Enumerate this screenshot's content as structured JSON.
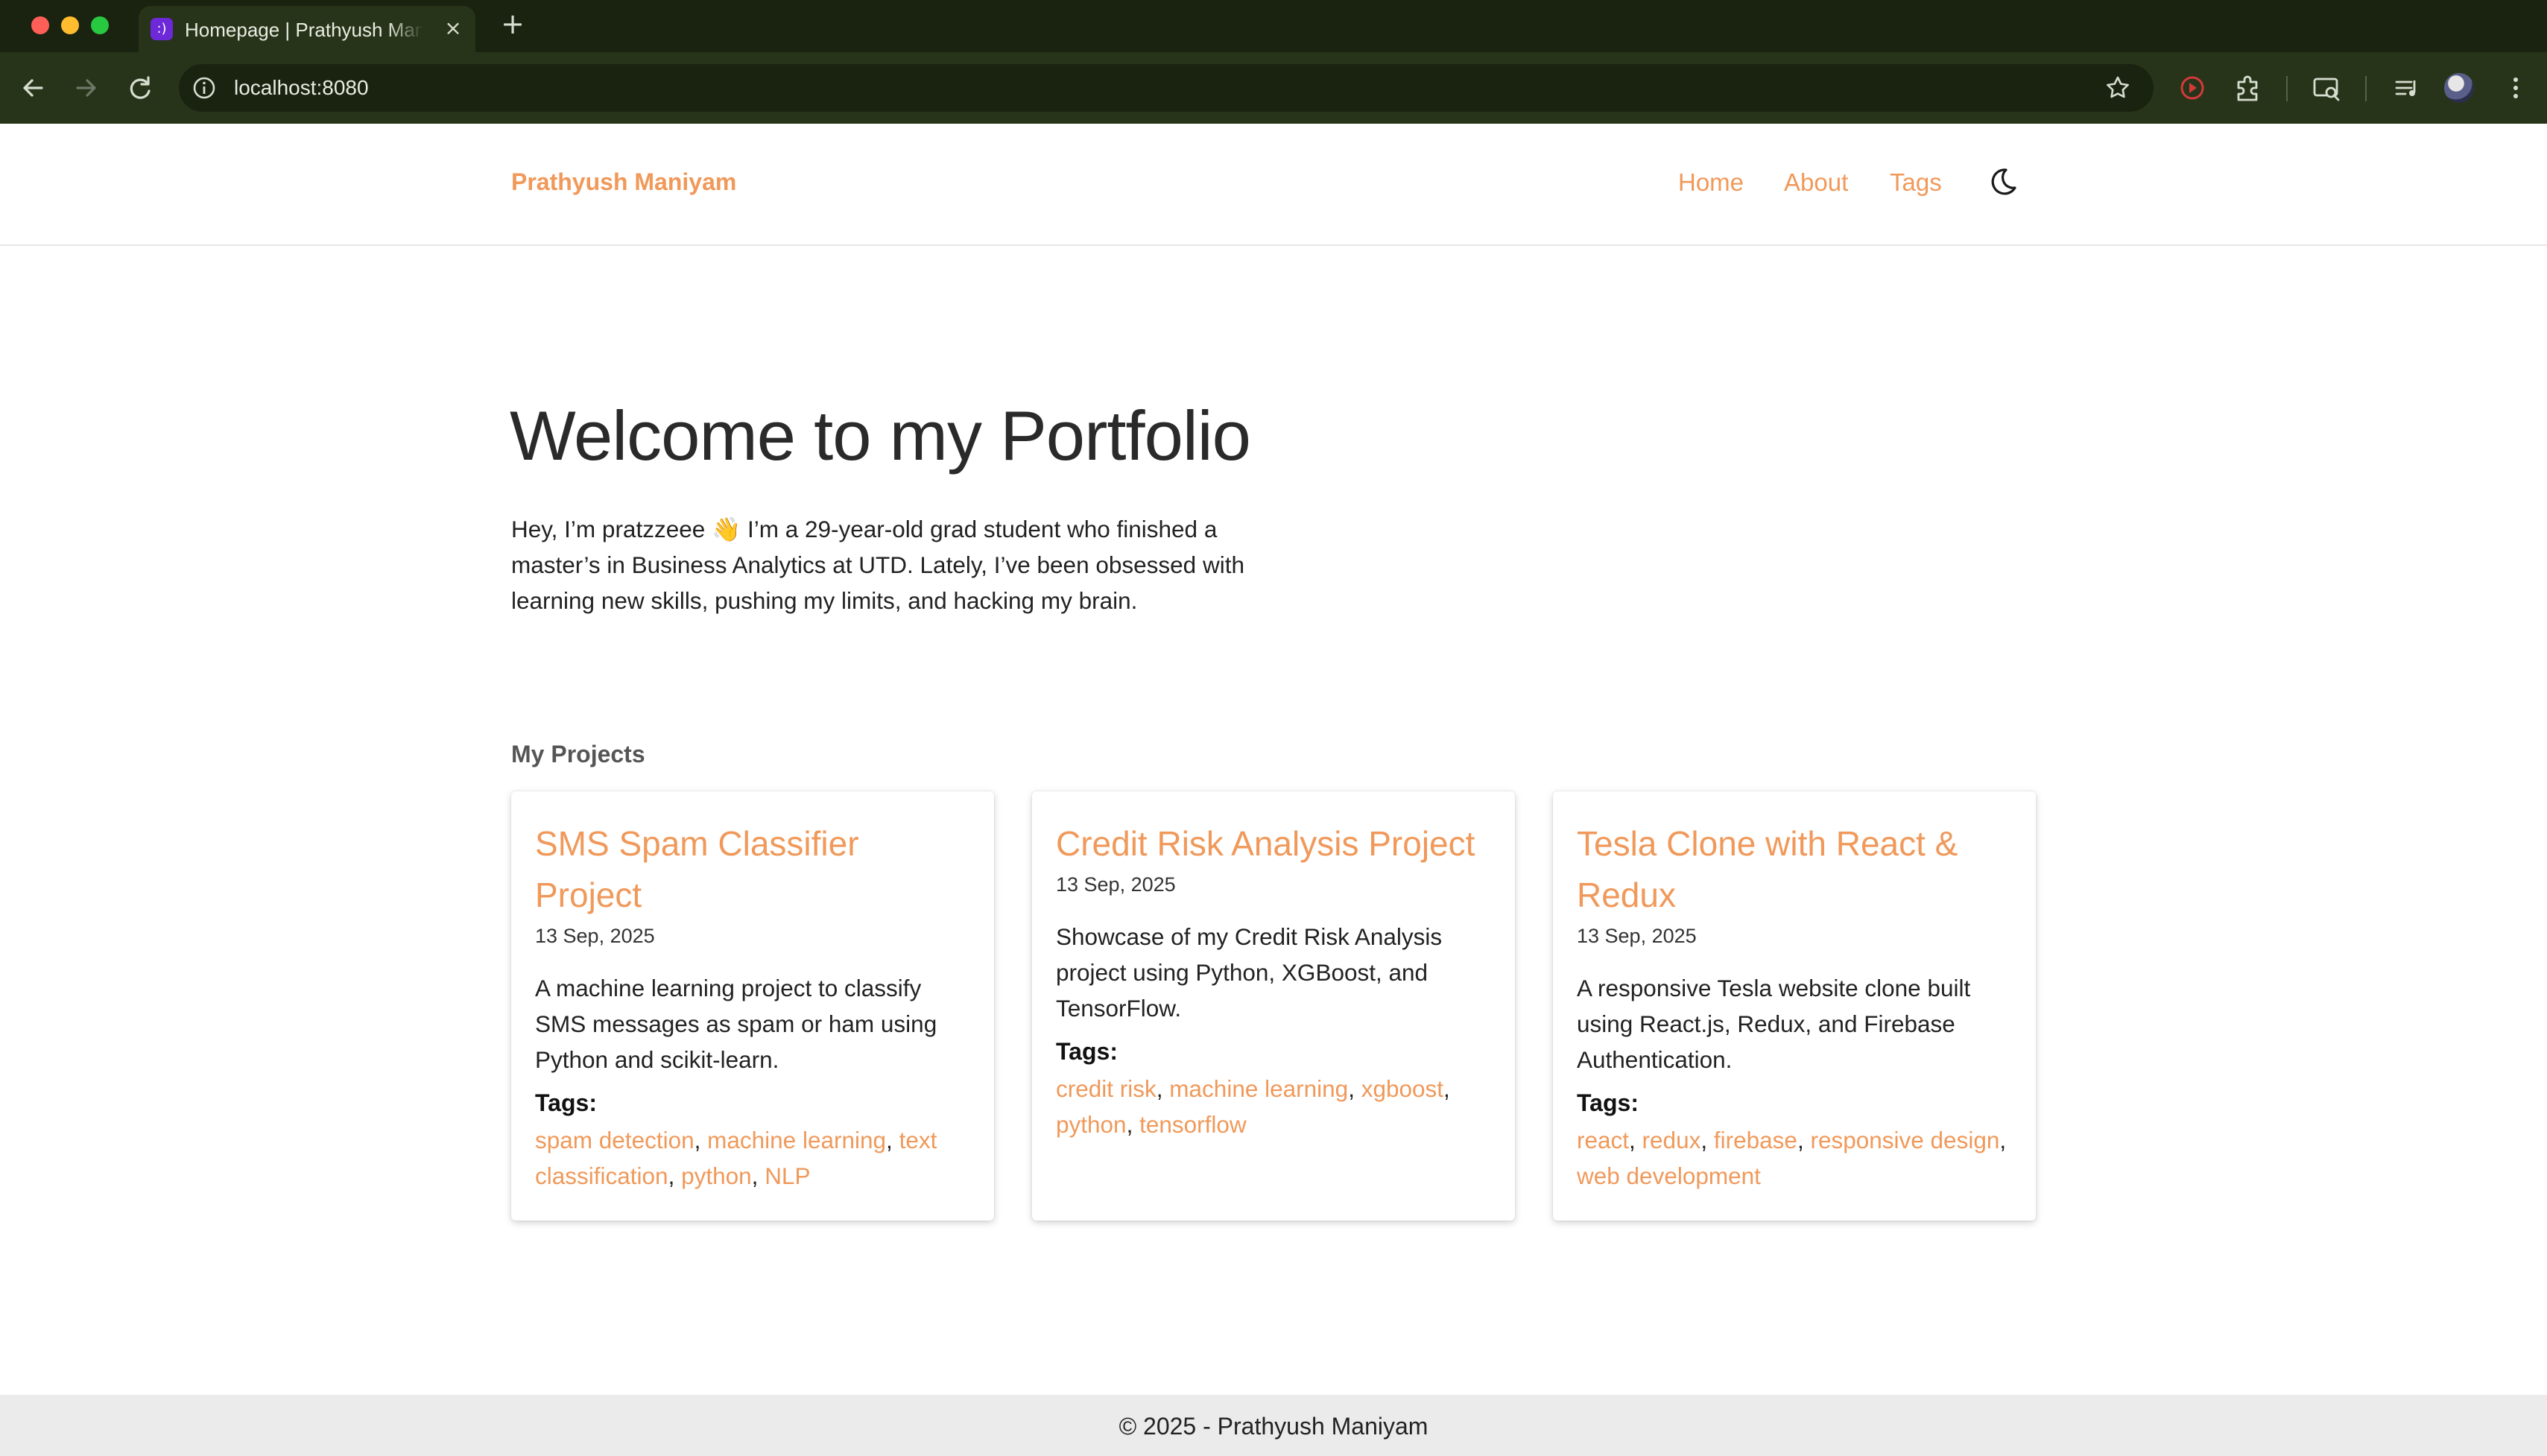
{
  "browser": {
    "tab_title": "Homepage | Prathyush Maniyam",
    "tab_favicon": ":)",
    "url": "localhost:8080",
    "new_tab_symbol": "+",
    "close_symbol": "×"
  },
  "site": {
    "brand": "Prathyush Maniyam",
    "nav": [
      {
        "label": "Home"
      },
      {
        "label": "About"
      },
      {
        "label": "Tags"
      }
    ],
    "accent_color": "#f0995a"
  },
  "hero": {
    "title": "Welcome to my Portfolio",
    "intro": "Hey, I’m pratzzeee 👋 I’m a 29-year-old grad student who finished a master’s in Business Analytics at UTD. Lately, I’ve been obsessed with learning new skills, pushing my limits, and hacking my brain."
  },
  "projects": {
    "heading": "My Projects",
    "tags_label": "Tags:",
    "items": [
      {
        "title": "SMS Spam Classifier Project",
        "date": "13 Sep, 2025",
        "description": "A machine learning project to classify SMS messages as spam or ham using Python and scikit-learn.",
        "tags": [
          "spam detection",
          "machine learning",
          "text classification",
          "python",
          "NLP"
        ]
      },
      {
        "title": "Credit Risk Analysis Project",
        "date": "13 Sep, 2025",
        "description": "Showcase of my Credit Risk Analysis project using Python, XGBoost, and TensorFlow.",
        "tags": [
          "credit risk",
          "machine learning",
          "xgboost",
          "python",
          "tensorflow"
        ]
      },
      {
        "title": "Tesla Clone with React & Redux",
        "date": "13 Sep, 2025",
        "description": "A responsive Tesla website clone built using React.js, Redux, and Firebase Authentication.",
        "tags": [
          "react",
          "redux",
          "firebase",
          "responsive design",
          "web development"
        ]
      }
    ]
  },
  "footer": {
    "text": "© 2025 - Prathyush Maniyam"
  }
}
